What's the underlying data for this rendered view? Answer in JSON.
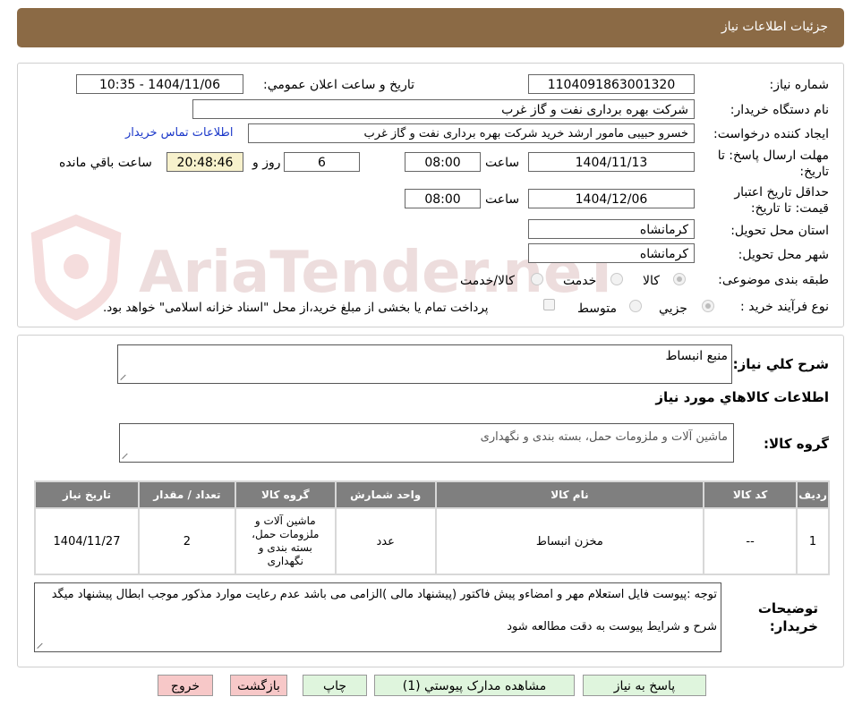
{
  "header": {
    "title": "جزئیات اطلاعات نیاز"
  },
  "watermark": {
    "text": "AriaTender.neT"
  },
  "form": {
    "need_number_label": "شماره نیاز:",
    "need_number": "1104091863001320",
    "announce_label": "تاریخ و ساعت اعلان عمومي:",
    "announce_value": "1404/11/06 - 10:35",
    "buyer_org_label": "نام دستگاه خریدار:",
    "buyer_org": "شرکت بهره برداری نفت و گاز غرب",
    "requester_label": "ایجاد کننده درخواست:",
    "requester": "خسرو حبیبی مامور ارشد خرید شرکت بهره برداری نفت و گاز غرب",
    "contact_link": "اطلاعات تماس خریدار",
    "deadline_label": "مهلت ارسال پاسخ: تا تاریخ:",
    "deadline_date": "1404/11/13",
    "time_label": "ساعت",
    "deadline_time": "08:00",
    "days_value": "6",
    "days_label": "روز و",
    "remaining_time": "20:48:46",
    "remaining_label": "ساعت باقي مانده",
    "validity_label": "حداقل تاریخ اعتبار قیمت: تا تاریخ:",
    "validity_date": "1404/12/06",
    "validity_time_label": "ساعت",
    "validity_time": "08:00",
    "province_label": "استان محل تحویل:",
    "province": "کرمانشاه",
    "city_label": "شهر محل تحویل:",
    "city": "کرمانشاه",
    "category_label": "طبقه بندی موضوعی:",
    "category_options": [
      "کالا",
      "خدمت",
      "کالا/خدمت"
    ],
    "process_label": "نوع فرآیند خرید :",
    "process_options": [
      "جزیي",
      "متوسط"
    ],
    "payment_note": "پرداخت تمام یا بخشی از مبلغ خرید،از محل \"اسناد خزانه اسلامی\" خواهد بود."
  },
  "summary": {
    "general_desc_label": "شرح کلي نیاز:",
    "general_desc": "منبع انبساط",
    "goods_info_title": "اطلاعات کالاهاي مورد نیاز",
    "goods_group_label": "گروه کالا:",
    "goods_group": "ماشین آلات و ملزومات حمل، بسته بندی و نگهداری"
  },
  "table": {
    "headers": [
      "ردیف",
      "کد کالا",
      "نام کالا",
      "واحد شمارش",
      "گروه کالا",
      "تعداد / مقدار",
      "تاریخ نیاز"
    ],
    "rows": [
      [
        "1",
        "--",
        "مخزن انبساط",
        "عدد",
        "ماشین آلات و ملزومات حمل، بسته بندی و نگهداری",
        "2",
        "1404/11/27"
      ]
    ]
  },
  "buyer_notes": {
    "label": "توضیحات خریدار:",
    "line1": "توجه :پیوست فایل استعلام مهر و امضاءو پیش فاکتور (پیشنهاد مالی )الزامی می باشد عدم رعایت موارد مذکور موجب ابطال پیشنهاد میگد",
    "line2": "شرح و شرایط پیوست به دقت مطالعه شود"
  },
  "buttons": {
    "reply": "پاسخ به نیاز",
    "attachments": "مشاهده مدارک پیوستي (1)",
    "print": "چاپ",
    "back": "بازگشت",
    "exit": "خروج"
  },
  "colors": {
    "header_bg": "#8b6a45",
    "link": "#1a37c9",
    "button_green": "#dff5dd",
    "button_red": "#f7c8c8",
    "table_header": "#7f7f7f"
  }
}
